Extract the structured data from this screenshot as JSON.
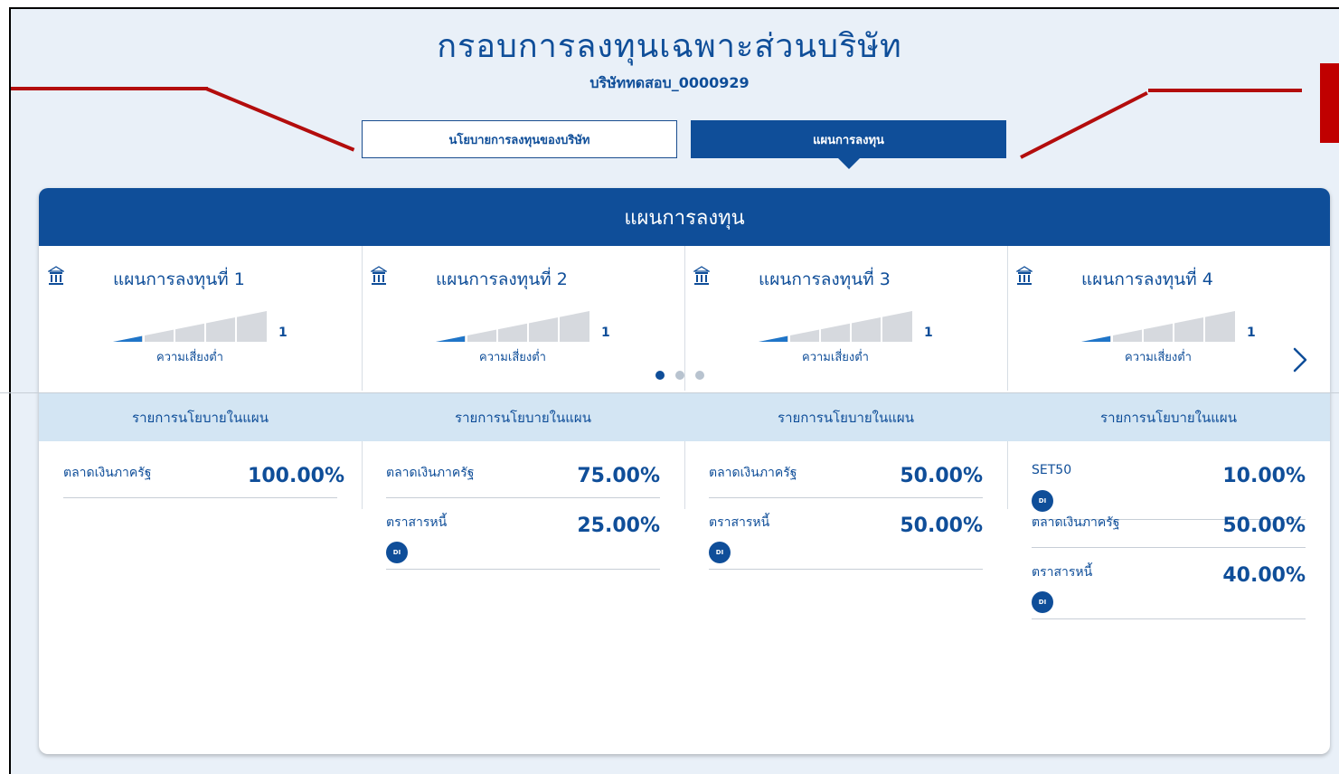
{
  "page": {
    "title": "กรอบการลงทุนเฉพาะส่วนบริษัท",
    "subtitle": "บริษัททดสอบ_0000929"
  },
  "tabs": [
    {
      "label": "นโยบายการลงทุนของบริษัท",
      "active": false
    },
    {
      "label": "แผนการลงทุน",
      "active": true
    }
  ],
  "panel": {
    "header": "แผนการลงทุน",
    "carousel": {
      "pages": 3,
      "current": 1
    },
    "plans": [
      {
        "name": "แผนการลงทุนที่ 1",
        "risk_level": "1",
        "risk_label": "ความเสี่ยงต่ำ"
      },
      {
        "name": "แผนการลงทุนที่ 2",
        "risk_level": "1",
        "risk_label": "ความเสี่ยงต่ำ"
      },
      {
        "name": "แผนการลงทุนที่ 3",
        "risk_level": "1",
        "risk_label": "ความเสี่ยงต่ำ"
      },
      {
        "name": "แผนการลงทุนที่ 4",
        "risk_level": "1",
        "risk_label": "ความเสี่ยงต่ำ"
      }
    ],
    "column_header": "รายการนโยบายในแผน",
    "policies": [
      [
        {
          "name": "ตลาดเงินภาครัฐ",
          "percent": "100.00%",
          "di": false
        }
      ],
      [
        {
          "name": "ตลาดเงินภาครัฐ",
          "percent": "75.00%",
          "di": false
        },
        {
          "name": "ตราสารหนี้",
          "percent": "25.00%",
          "di": true
        }
      ],
      [
        {
          "name": "ตลาดเงินภาครัฐ",
          "percent": "50.00%",
          "di": false
        },
        {
          "name": "ตราสารหนี้",
          "percent": "50.00%",
          "di": true
        }
      ],
      [
        {
          "name": "SET50",
          "percent": "10.00%",
          "di": true
        },
        {
          "name": "ตลาดเงินภาครัฐ",
          "percent": "50.00%",
          "di": false
        },
        {
          "name": "ตราสารหนี้",
          "percent": "40.00%",
          "di": true
        }
      ]
    ],
    "di_badge_label": "DI"
  },
  "colors": {
    "primary": "#0f4e99",
    "header_light": "#d3e5f3",
    "background": "#e9f0f8",
    "annotation": "#b30d0d"
  }
}
